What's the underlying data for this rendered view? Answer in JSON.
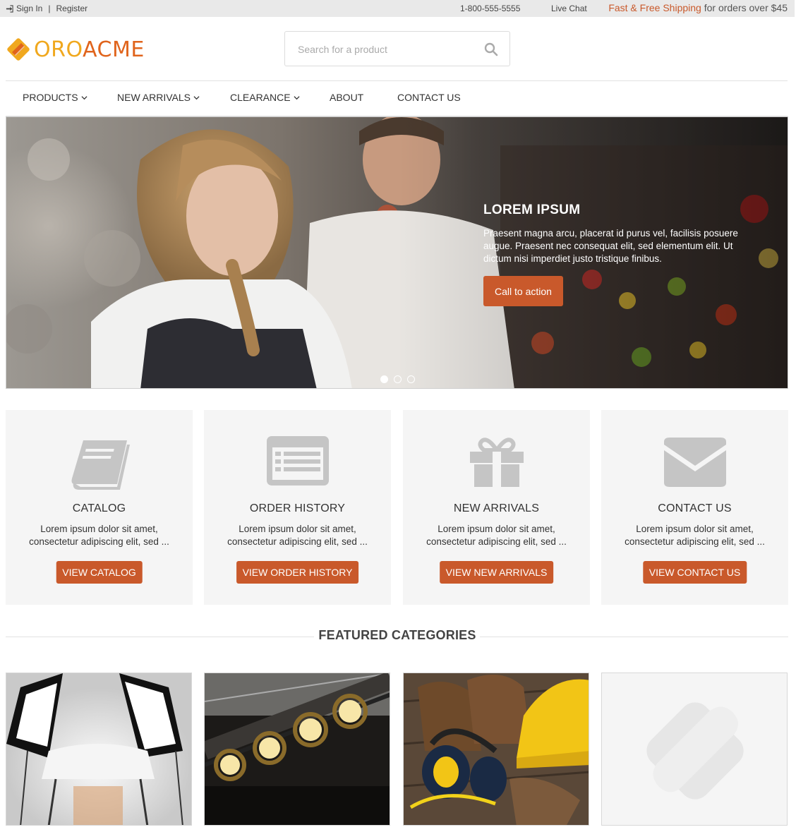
{
  "topbar": {
    "sign_in": "Sign In",
    "separator": "|",
    "register": "Register",
    "phone": "1-800-555-5555",
    "live_chat": "Live Chat",
    "shipping_accent": "Fast & Free Shipping",
    "shipping_rest": " for orders over $45"
  },
  "logo": {
    "part1": "ORO",
    "part2": "ACME"
  },
  "search": {
    "placeholder": "Search for a product"
  },
  "nav": {
    "products": "PRODUCTS",
    "new_arrivals": "NEW ARRIVALS",
    "clearance": "CLEARANCE",
    "about": "ABOUT",
    "contact_us": "CONTACT US"
  },
  "hero": {
    "title": "LOREM IPSUM",
    "description": "Praesent magna arcu, placerat id purus vel, facilisis posuere augue. Praesent nec consequat elit, sed elementum elit. Ut dictum nisi imperdiet justo tristique finibus.",
    "cta": "Call to action",
    "active_slide": 1,
    "slide_count": 3
  },
  "cards": [
    {
      "title": "CATALOG",
      "desc": "Lorem ipsum dolor sit amet, consectetur adipiscing elit, sed ...",
      "button": "VIEW CATALOG",
      "icon": "book-icon"
    },
    {
      "title": "ORDER HISTORY",
      "desc": "Lorem ipsum dolor sit amet, consectetur adipiscing elit, sed ...",
      "button": "VIEW ORDER HISTORY",
      "icon": "list-alt-icon"
    },
    {
      "title": "NEW ARRIVALS",
      "desc": "Lorem ipsum dolor sit amet, consectetur adipiscing elit, sed ...",
      "button": "VIEW NEW ARRIVALS",
      "icon": "gift-icon"
    },
    {
      "title": "CONTACT US",
      "desc": "Lorem ipsum dolor sit amet, consectetur adipiscing elit, sed ...",
      "button": "VIEW CONTACT US",
      "icon": "envelope-icon"
    }
  ],
  "featured": {
    "title": "FEATURED CATEGORIES"
  },
  "colors": {
    "accent": "#c9592b",
    "logo_orange": "#e0641c",
    "logo_yellow": "#f0a81e",
    "card_bg": "#f5f5f5"
  }
}
